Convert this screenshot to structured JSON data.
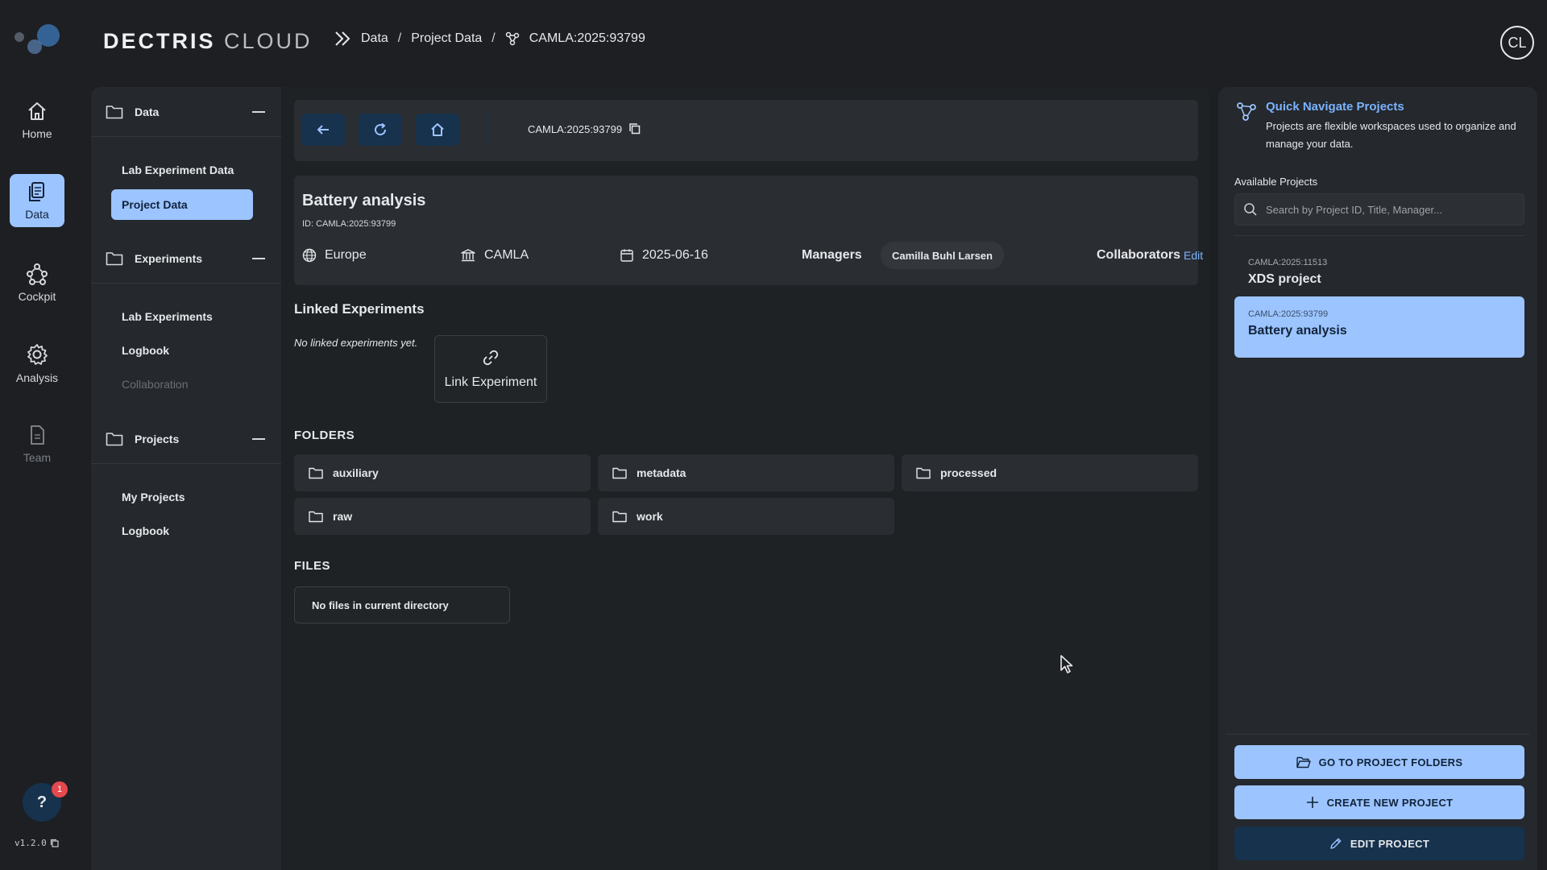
{
  "header": {
    "brand_bold": "DECTRIS",
    "brand_light": "CLOUD",
    "breadcrumb": [
      "Data",
      "Project Data",
      "CAMLA:2025:93799"
    ],
    "avatar_initials": "CL"
  },
  "rail": {
    "items": [
      {
        "label": "Home",
        "icon": "home-icon"
      },
      {
        "label": "Data",
        "icon": "documents-icon"
      },
      {
        "label": "Cockpit",
        "icon": "network-icon"
      },
      {
        "label": "Analysis",
        "icon": "gear-icon"
      },
      {
        "label": "Team",
        "icon": "document-icon"
      }
    ],
    "help_label": "?",
    "help_badge": "1",
    "version": "v1.2.0"
  },
  "nav": {
    "sections": [
      {
        "title": "Data",
        "items": [
          "Lab Experiment Data",
          "Project Data"
        ]
      },
      {
        "title": "Experiments",
        "items": [
          "Lab Experiments",
          "Logbook",
          "Collaboration"
        ]
      },
      {
        "title": "Projects",
        "items": [
          "My Projects",
          "Logbook"
        ]
      }
    ]
  },
  "toolbar": {
    "current_id": "CAMLA:2025:93799"
  },
  "project": {
    "title": "Battery analysis",
    "id_line": "ID: CAMLA:2025:93799",
    "region": "Europe",
    "facility": "CAMLA",
    "date": "2025-06-16",
    "managers_label": "Managers",
    "manager": "Camilla Buhl Larsen",
    "collaborators_label": "Collaborators",
    "edit_label": "Edit"
  },
  "linked": {
    "title": "Linked Experiments",
    "empty": "No linked experiments yet.",
    "link_button": "Link Experiment"
  },
  "folders": {
    "title": "FOLDERS",
    "items": [
      "auxiliary",
      "metadata",
      "processed",
      "raw",
      "work"
    ]
  },
  "files": {
    "title": "FILES",
    "empty": "No files in current directory"
  },
  "quick_nav": {
    "title": "Quick Navigate Projects",
    "description": "Projects are flexible workspaces used to organize and manage your data.",
    "available_label": "Available Projects",
    "search_placeholder": "Search by Project ID, Title, Manager...",
    "projects": [
      {
        "id": "CAMLA:2025:11513",
        "name": "XDS project"
      },
      {
        "id": "CAMLA:2025:93799",
        "name": "Battery analysis"
      }
    ],
    "buttons": {
      "go_folders": "GO TO PROJECT FOLDERS",
      "create": "CREATE NEW PROJECT",
      "edit": "EDIT PROJECT"
    }
  },
  "colors": {
    "accent": "#9cc4ff",
    "link": "#7ab3ff",
    "dark_button": "#16324d",
    "badge": "#e5484d"
  }
}
